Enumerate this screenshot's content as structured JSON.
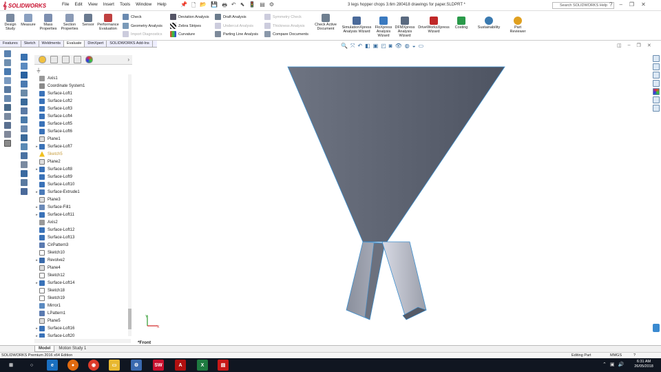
{
  "app": {
    "logo_text": "SOLIDWORKS",
    "document_title": "3 legs hopper chops 3.6m 280418 drawings for paper.SLDPRT *",
    "search_placeholder": "Search SOLIDWORKS Help"
  },
  "menu": [
    "File",
    "Edit",
    "View",
    "Insert",
    "Tools",
    "Window",
    "Help"
  ],
  "ribbon": {
    "design_study": "Design Study",
    "measure": "Measure",
    "mass_properties": "Mass Properties",
    "section_properties": "Section Properties",
    "sensor": "Sensor",
    "performance_evaluation": "Performance Evaluation",
    "check": "Check",
    "geometry_analysis": "Geometry Analysis",
    "import_diagnostics": "Import Diagnostics",
    "deviation_analysis": "Deviation Analysis",
    "zebra_stripes": "Zebra Stripes",
    "curvature": "Curvature",
    "draft_analysis": "Draft Analysis",
    "undercut_analysis": "Undercut Analysis",
    "parting_line_analysis": "Parting Line Analysis",
    "symmetry_check": "Symmetry Check",
    "thickness_analysis": "Thickness Analysis",
    "compare_documents": "Compare Documents",
    "check_active_document": "Check Active Document",
    "simulationxpress": "SimulationXpress Analysis Wizard",
    "floxpress": "FloXpress Analysis Wizard",
    "dfmxpress": "DFMXpress Analysis Wizard",
    "driveworksxpress": "DriveWorksXpress Wizard",
    "costing": "Costing",
    "sustainability": "Sustainability",
    "part_reviewer": "Part Reviewer"
  },
  "command_tabs": [
    "Features",
    "Sketch",
    "Weldments",
    "Evaluate",
    "DimXpert",
    "SOLIDWORKS Add-Ins"
  ],
  "active_command_tab": "Evaluate",
  "tree": [
    {
      "label": "Axis1",
      "icon": "axis",
      "expand": false
    },
    {
      "label": "Coordinate System1",
      "icon": "coord",
      "expand": false
    },
    {
      "label": "Surface-Loft1",
      "icon": "loft",
      "expand": false
    },
    {
      "label": "Surface-Loft2",
      "icon": "loft",
      "expand": false
    },
    {
      "label": "Surface-Loft3",
      "icon": "loft",
      "expand": false
    },
    {
      "label": "Surface-Loft4",
      "icon": "loft",
      "expand": false
    },
    {
      "label": "Surface-Loft5",
      "icon": "loft",
      "expand": false
    },
    {
      "label": "Surface-Loft6",
      "icon": "loft",
      "expand": false
    },
    {
      "label": "Plane1",
      "icon": "plane",
      "expand": false
    },
    {
      "label": "Surface-Loft7",
      "icon": "loft",
      "expand": true
    },
    {
      "label": "Sketch5",
      "icon": "warning",
      "expand": false
    },
    {
      "label": "Plane2",
      "icon": "plane",
      "expand": false
    },
    {
      "label": "Surface-Loft8",
      "icon": "loft",
      "expand": true
    },
    {
      "label": "Surface-Loft9",
      "icon": "loft",
      "expand": false
    },
    {
      "label": "Surface-Loft10",
      "icon": "loft",
      "expand": false
    },
    {
      "label": "Surface-Extrude1",
      "icon": "extrude",
      "expand": true
    },
    {
      "label": "Plane3",
      "icon": "plane",
      "expand": false
    },
    {
      "label": "Surface-Fill1",
      "icon": "fill",
      "expand": true
    },
    {
      "label": "Surface-Loft11",
      "icon": "loft",
      "expand": true
    },
    {
      "label": "Axis2",
      "icon": "axis",
      "expand": false
    },
    {
      "label": "Surface-Loft12",
      "icon": "loft",
      "expand": false
    },
    {
      "label": "Surface-Loft13",
      "icon": "loft",
      "expand": false
    },
    {
      "label": "CirPattern3",
      "icon": "pattern",
      "expand": false
    },
    {
      "label": "Sketch10",
      "icon": "sketch",
      "expand": false
    },
    {
      "label": "Revolve2",
      "icon": "revolve",
      "expand": true
    },
    {
      "label": "Plane4",
      "icon": "plane",
      "expand": false
    },
    {
      "label": "Sketch12",
      "icon": "sketch",
      "expand": false
    },
    {
      "label": "Surface-Loft14",
      "icon": "loft",
      "expand": true
    },
    {
      "label": "Sketch18",
      "icon": "sketch",
      "expand": false
    },
    {
      "label": "Sketch19",
      "icon": "sketch",
      "expand": false
    },
    {
      "label": "Mirror1",
      "icon": "mirror",
      "expand": false
    },
    {
      "label": "LPattern1",
      "icon": "pattern",
      "expand": false
    },
    {
      "label": "Plane5",
      "icon": "plane",
      "expand": false
    },
    {
      "label": "Surface-Loft16",
      "icon": "loft",
      "expand": true
    },
    {
      "label": "Surface-Loft20",
      "icon": "loft",
      "expand": true
    }
  ],
  "viewport": {
    "view_label": "*Front"
  },
  "bottom_tabs": [
    "Model",
    "Motion Study 1"
  ],
  "active_bottom_tab": "Model",
  "status": {
    "edition": "SOLIDWORKS Premium 2016 x64 Edition",
    "mode": "Editing Part",
    "units": "MMGS"
  },
  "taskbar": {
    "time": "6:31 AM",
    "date": "26/05/2018"
  },
  "colors": {
    "brand": "#c8102e",
    "model_dark": "#5a5f6b",
    "model_light": "#c9ccd6",
    "edge": "#3b8fd0",
    "taskbar": "#101621"
  }
}
